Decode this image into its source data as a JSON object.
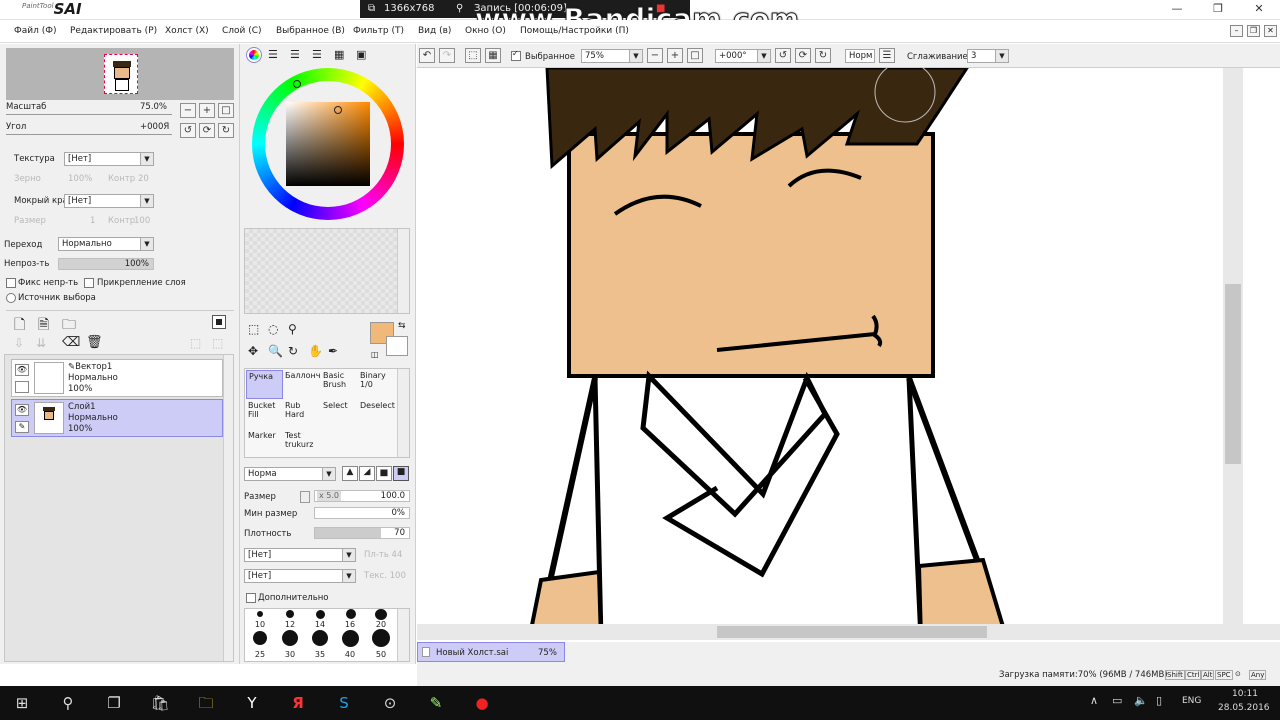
{
  "app": {
    "logo_small": "PaintTool",
    "logo_big": "SAI",
    "window_controls": [
      "—",
      "❐",
      "✕"
    ]
  },
  "recorder": {
    "resolution": "1366x768",
    "recording": "Запись [00:06:09]",
    "watermark": "www.Bandicam.com"
  },
  "menu": {
    "items": [
      "Файл (Ф)",
      "Редактировать (Р)",
      "Холст (Х)",
      "Слой (С)",
      "Выбранное (В)",
      "Фильтр (Т)",
      "Вид (в)",
      "Окно (О)",
      "Помощь/Настройки (П)"
    ]
  },
  "navigator": {
    "scale_label": "Масштаб",
    "scale_value": "75.0%",
    "angle_label": "Угол",
    "angle_value": "+000Я"
  },
  "brush_settings": {
    "texture_label": "Текстура",
    "texture_value": "[Нет]",
    "grain_label": "Зерно",
    "grain_value": "100%",
    "contrast_label": "Контр",
    "contrast_value": "20",
    "wet_edge_label": "Мокрый край",
    "wet_edge_value": "[Нет]",
    "size_label": "Размер",
    "size_value": "1",
    "contrast2_label": "Контр",
    "contrast2_value": "100"
  },
  "layer_settings": {
    "blend_label": "Переход",
    "blend_value": "Нормально",
    "opacity_label": "Непроз-ть",
    "opacity_value": "100%",
    "lock_opacity": "Фикс непр-ть",
    "clip_layer": "Прикрепление слоя",
    "selection_source": "Источник выбора"
  },
  "layers": [
    {
      "name": "Вектор1",
      "mode": "Нормально",
      "opacity": "100%",
      "active": false
    },
    {
      "name": "Слой1",
      "mode": "Нормально",
      "opacity": "100%",
      "active": true
    }
  ],
  "color": {
    "primary": "#f0b97a",
    "hue_marker": "#ff9a00"
  },
  "tools": [
    [
      "Ручка",
      "Баллонч",
      "Basic Brush",
      "Binary 1/0"
    ],
    [
      "Bucket Fill",
      "Rub Hard",
      "Select",
      "Deselect"
    ],
    [
      "Marker",
      "Test trukurz",
      "",
      ""
    ]
  ],
  "tool_options": {
    "mode_value": "Норма",
    "size_label": "Размер",
    "size_multiplier": "x 5.0",
    "size_value": "100.0",
    "min_size_label": "Мин размер",
    "min_size_value": "0%",
    "density_label": "Плотность",
    "density_value": "70",
    "shape1_value": "[Нет]",
    "shape1_right": "Пл-ть 44",
    "shape2_value": "[Нет]",
    "shape2_right": "Текс. 100",
    "advanced_label": "Дополнительно"
  },
  "brush_sizes": {
    "row1": [
      "10",
      "12",
      "14",
      "16",
      "20"
    ],
    "row2": [
      "25",
      "30",
      "35",
      "40",
      "50"
    ]
  },
  "canvas_toolbar": {
    "selection_label": "Выбранное",
    "zoom_value": "75%",
    "angle_value": "+000°",
    "mode_value": "Норм",
    "stabilizer_label": "Сглаживание",
    "stabilizer_value": "3"
  },
  "status": {
    "tab_name": "Новый Холст.sai",
    "tab_zoom": "75%",
    "memory": "Загрузка памяти:70% (96MB / 746MB)",
    "keys": [
      "Shift",
      "Ctrl",
      "Alt",
      "SPC",
      "⊙",
      "Any"
    ]
  },
  "taskbar": {
    "lang": "ENG",
    "time": "10:11",
    "date": "28.05.2016"
  }
}
